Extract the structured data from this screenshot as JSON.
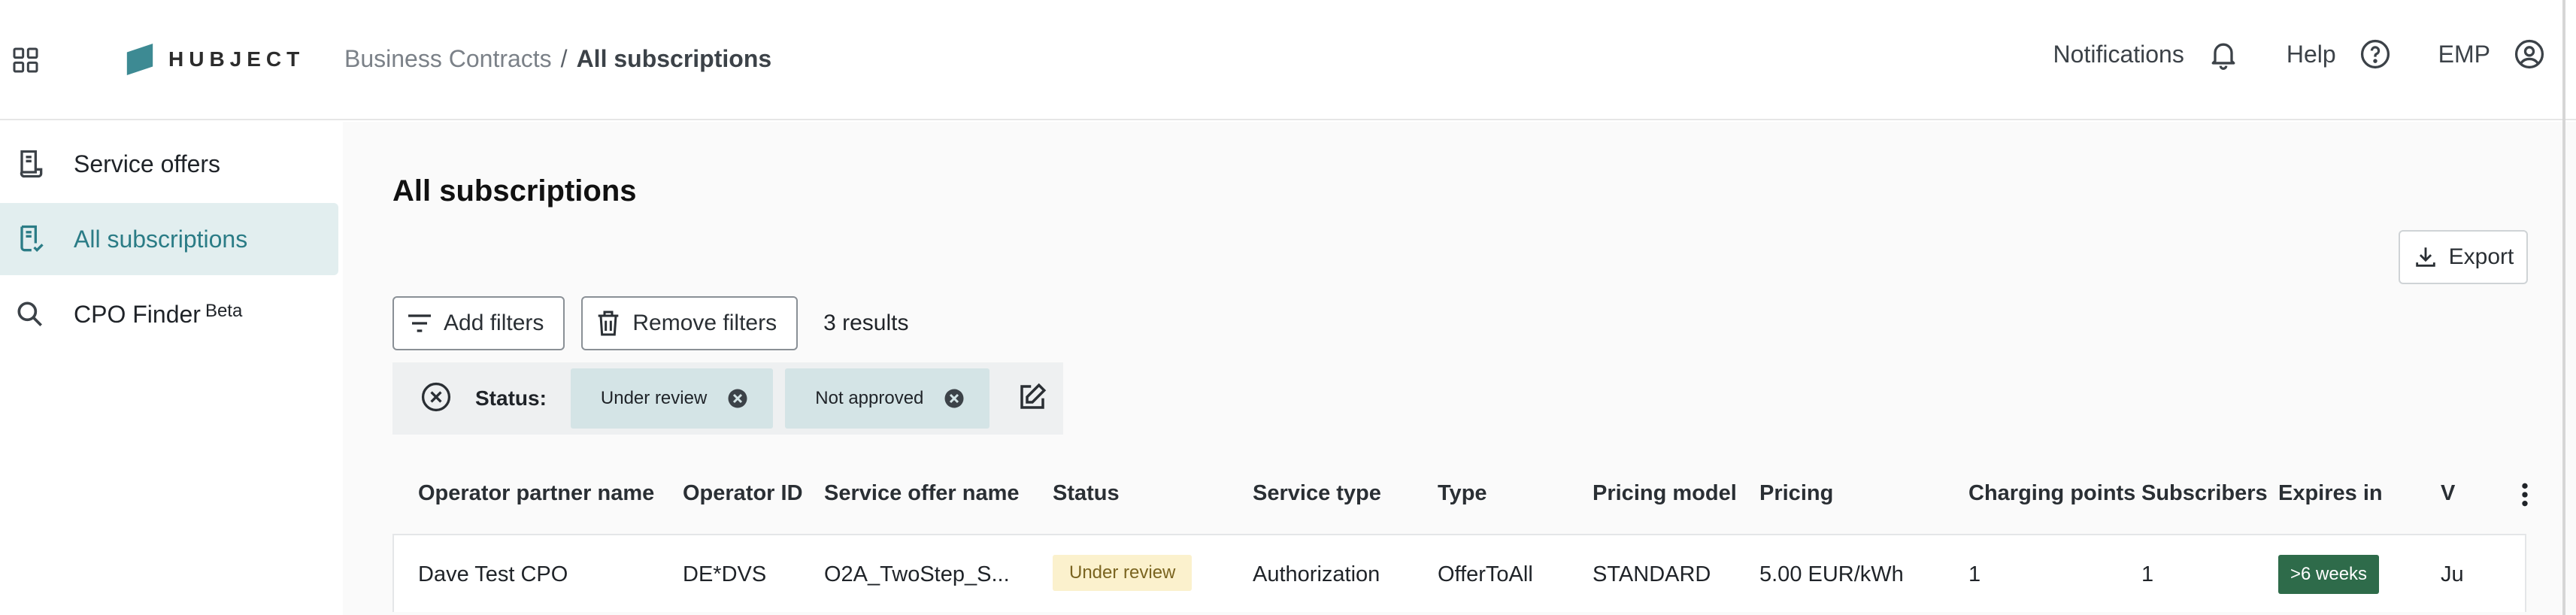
{
  "brand": {
    "wordmark": "HUBJECT",
    "accent_color": "#2b7c86"
  },
  "header": {
    "breadcrumb": {
      "parent": "Business Contracts",
      "separator": "/",
      "current": "All subscriptions"
    },
    "actions": {
      "notifications_label": "Notifications",
      "help_label": "Help",
      "account_label": "EMP"
    },
    "icons": [
      "apps-grid-icon",
      "bell-icon",
      "help-circle-icon",
      "account-circle-icon"
    ]
  },
  "sidebar": {
    "items": [
      {
        "label": "Service offers",
        "icon": "document-icon",
        "active": false
      },
      {
        "label": "All subscriptions",
        "icon": "document-check-icon",
        "active": true
      },
      {
        "label": "CPO Finder",
        "icon": "search-icon",
        "active": false,
        "badge": "Beta"
      }
    ]
  },
  "main": {
    "title": "All subscriptions",
    "export_label": "Export",
    "filters": {
      "add_label": "Add filters",
      "remove_label": "Remove filters",
      "results": "3 results",
      "status_label": "Status:",
      "chips": [
        "Under review",
        "Not approved"
      ]
    },
    "table": {
      "columns": [
        "Operator partner name",
        "Operator ID",
        "Service offer name",
        "Status",
        "Service type",
        "Type",
        "Pricing model",
        "Pricing",
        "Charging points",
        "Subscribers",
        "Expires in",
        "V"
      ],
      "rows": [
        {
          "operator_partner_name": "Dave Test CPO",
          "operator_id": "DE*DVS",
          "service_offer_name": "O2A_TwoStep_S...",
          "status": "Under review",
          "service_type": "Authorization",
          "type": "OfferToAll",
          "pricing_model": "STANDARD",
          "pricing": "5.00 EUR/kWh",
          "charging_points": "1",
          "subscribers": "1",
          "expires_in": ">6 weeks",
          "valid": "Ju"
        }
      ]
    }
  },
  "colors": {
    "active_bg": "#e2eeef",
    "chip_bg": "#d4e4e6",
    "review_badge_bg": "#fbf1cd",
    "weeks_badge_bg": "#2e6b4a"
  }
}
